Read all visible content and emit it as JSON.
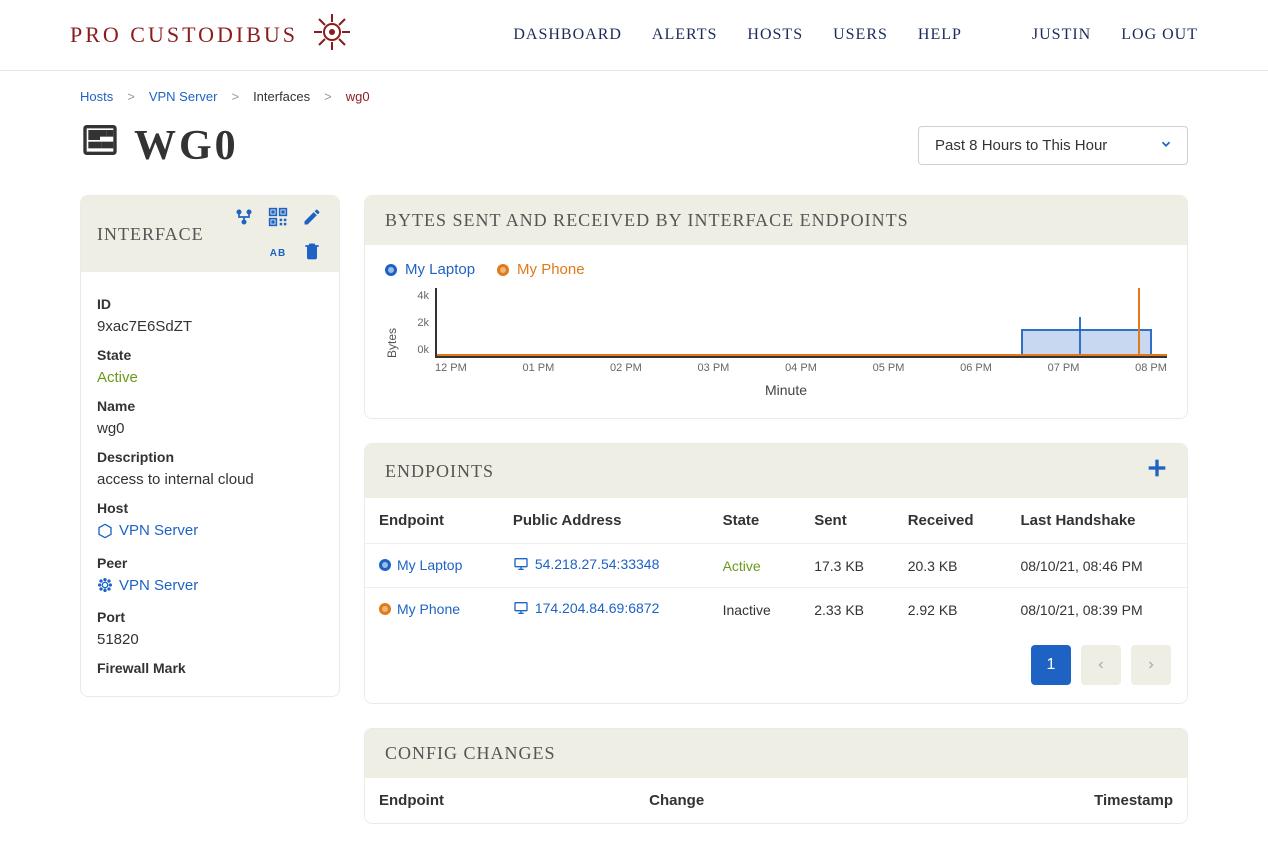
{
  "brand": "PRO CUSTODIBUS",
  "nav": {
    "dashboard": "DASHBOARD",
    "alerts": "ALERTS",
    "hosts": "HOSTS",
    "users": "USERS",
    "help": "HELP",
    "user": "JUSTIN",
    "logout": "LOG OUT"
  },
  "breadcrumb": {
    "hosts": "Hosts",
    "host": "VPN Server",
    "interfaces": "Interfaces",
    "current": "wg0"
  },
  "title": "WG0",
  "timerange": "Past 8 Hours to This Hour",
  "interface": {
    "heading": "INTERFACE",
    "ab_label": "ab",
    "fields": {
      "id": {
        "label": "ID",
        "value": "9xac7E6SdZT"
      },
      "state": {
        "label": "State",
        "value": "Active"
      },
      "name": {
        "label": "Name",
        "value": "wg0"
      },
      "description": {
        "label": "Description",
        "value": "access to internal cloud"
      },
      "host": {
        "label": "Host",
        "value": "VPN Server"
      },
      "peer": {
        "label": "Peer",
        "value": "VPN Server"
      },
      "port": {
        "label": "Port",
        "value": "51820"
      },
      "firewall": {
        "label": "Firewall Mark"
      }
    }
  },
  "chart": {
    "heading": "BYTES SENT AND RECEIVED BY INTERFACE ENDPOINTS",
    "legend": {
      "peer1": "My Laptop",
      "peer2": "My Phone"
    },
    "ylabel": "Bytes",
    "xlabel": "Minute",
    "yticks": [
      "4k",
      "2k",
      "0k"
    ],
    "xticks": [
      "12 PM",
      "01 PM",
      "02 PM",
      "03 PM",
      "04 PM",
      "05 PM",
      "06 PM",
      "07 PM",
      "08 PM"
    ]
  },
  "chart_data": {
    "type": "area",
    "title": "BYTES SENT AND RECEIVED BY INTERFACE ENDPOINTS",
    "xlabel": "Minute",
    "ylabel": "Bytes",
    "ylim": [
      0,
      4000
    ],
    "x": [
      "12 PM",
      "01 PM",
      "02 PM",
      "03 PM",
      "04 PM",
      "05 PM",
      "06 PM",
      "07 PM",
      "07:15 PM",
      "07:30 PM",
      "08 PM",
      "08:40 PM"
    ],
    "series": [
      {
        "name": "My Laptop",
        "color": "#1e63c4",
        "values": [
          0,
          0,
          0,
          0,
          0,
          0,
          0,
          0,
          1500,
          1500,
          1500,
          1500
        ]
      },
      {
        "name": "My Phone",
        "color": "#e07a1c",
        "values": [
          0,
          0,
          0,
          0,
          0,
          0,
          0,
          0,
          0,
          0,
          0,
          4000
        ]
      }
    ]
  },
  "endpoints": {
    "heading": "ENDPOINTS",
    "columns": [
      "Endpoint",
      "Public Address",
      "State",
      "Sent",
      "Received",
      "Last Handshake"
    ],
    "rows": [
      {
        "name": "My Laptop",
        "color": "b",
        "addr": "54.218.27.54:33348",
        "state": "Active",
        "sent": "17.3 KB",
        "recv": "20.3 KB",
        "last": "08/10/21, 08:46 PM"
      },
      {
        "name": "My Phone",
        "color": "o",
        "addr": "174.204.84.69:6872",
        "state": "Inactive",
        "sent": "2.33 KB",
        "recv": "2.92 KB",
        "last": "08/10/21, 08:39 PM"
      }
    ],
    "page": "1"
  },
  "config": {
    "heading": "CONFIG CHANGES",
    "columns": [
      "Endpoint",
      "Change",
      "Timestamp"
    ]
  }
}
